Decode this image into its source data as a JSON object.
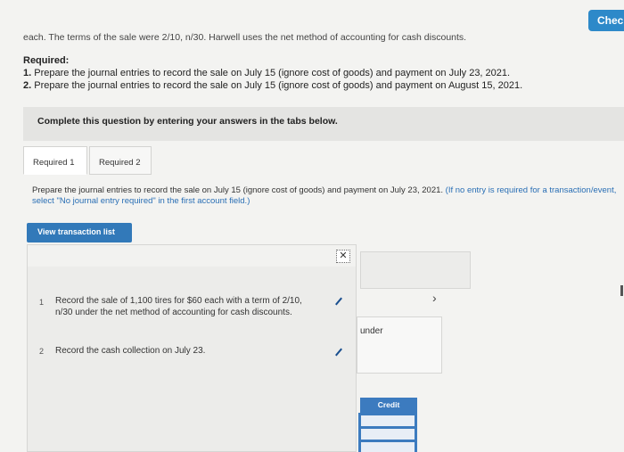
{
  "header": {
    "check_label": "Check"
  },
  "intro_text": "each. The terms of the sale were 2/10, n/30. Harwell uses the net method of accounting for cash discounts.",
  "required": {
    "heading": "Required:",
    "items": [
      {
        "num": "1.",
        "text": "Prepare the journal entries to record the sale on July 15 (ignore cost of goods) and payment on July 23, 2021."
      },
      {
        "num": "2.",
        "text": "Prepare the journal entries to record the sale on July 15 (ignore cost of goods) and payment on August 15, 2021."
      }
    ]
  },
  "tabs_banner": "Complete this question by entering your answers in the tabs below.",
  "tabs": [
    {
      "label": "Required 1",
      "active": true
    },
    {
      "label": "Required 2",
      "active": false
    }
  ],
  "instructions": {
    "main": "Prepare the journal entries to record the sale on July 15 (ignore cost of goods) and payment on July 23, 2021.",
    "note": "(If no entry is required for a transaction/event, select \"No journal entry required\" in the first account field.)"
  },
  "view_transaction_label": "View transaction list",
  "close_glyph": "✕",
  "transactions": [
    {
      "num": "1",
      "text": "Record the sale of 1,100 tires for $60 each with a term of 2/10, n/30 under the net method of accounting for cash discounts."
    },
    {
      "num": "2",
      "text": "Record the cash collection on July 23."
    }
  ],
  "chevron_glyph": "›",
  "under_text": "under",
  "credit_label": "Credit",
  "colors": {
    "accent": "#2d89c9",
    "tab_button": "#3279b9"
  }
}
